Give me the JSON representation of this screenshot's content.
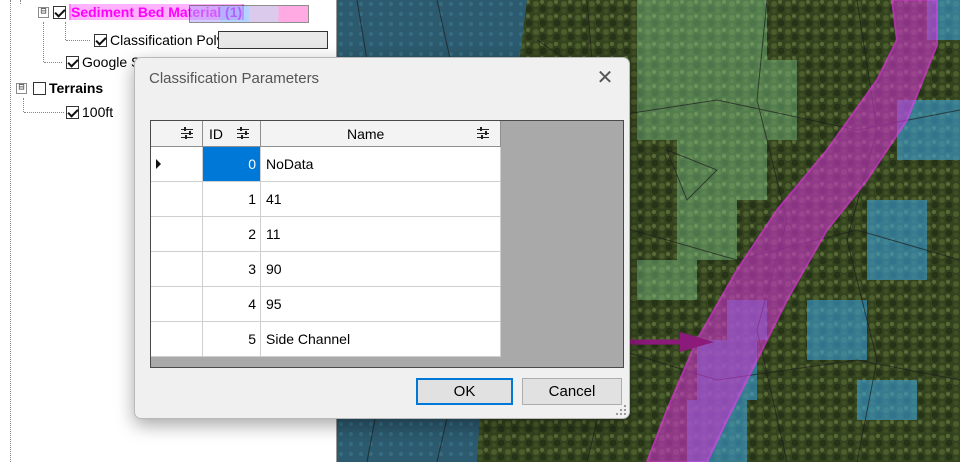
{
  "tree": {
    "items": [
      {
        "label": "Sediment Bed Material (1)",
        "checked": true,
        "expander": "⊟"
      },
      {
        "label": "Classification Polygons",
        "checked": true
      },
      {
        "label": "Google Satellite",
        "checked": true
      },
      {
        "label": "Terrains",
        "checked": false,
        "expander": "⊟"
      },
      {
        "label": "100ft",
        "checked": true
      }
    ],
    "highlight_color": "#ff66ff"
  },
  "dialog": {
    "title": "Classification Parameters",
    "close_label": "✕",
    "columns": [
      "ID",
      "Name"
    ],
    "rows": [
      {
        "id": "0",
        "name": "NoData"
      },
      {
        "id": "1",
        "name": "41"
      },
      {
        "id": "2",
        "name": "11"
      },
      {
        "id": "3",
        "name": "90"
      },
      {
        "id": "4",
        "name": "95"
      },
      {
        "id": "5",
        "name": "Side Channel"
      }
    ],
    "selected_row": 0,
    "ok_label": "OK",
    "cancel_label": "Cancel"
  },
  "colors": {
    "selection": "#0078d7",
    "annotation_arrow": "#8b1a7a",
    "channel_fill": "#cc33cc"
  },
  "icons": [
    "filter-icon",
    "row-pointer-icon",
    "close-icon",
    "resize-grip-icon",
    "annotation-arrow"
  ]
}
